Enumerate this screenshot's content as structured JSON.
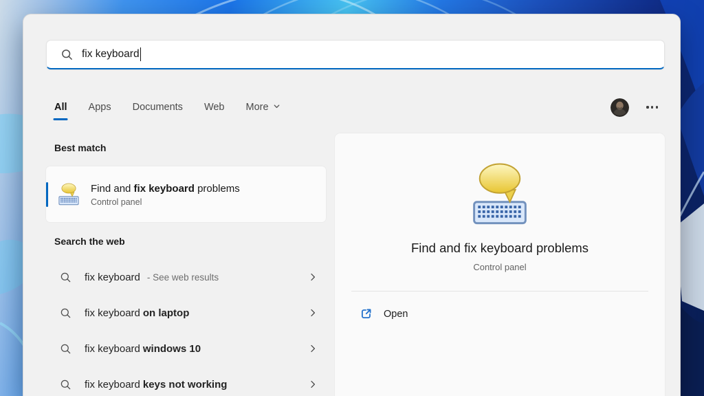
{
  "accent_color": "#0067c0",
  "search_bar": {
    "icon": "search-icon",
    "query": "fix keyboard"
  },
  "tabs": [
    "All",
    "Apps",
    "Documents",
    "Web",
    "More"
  ],
  "header_actions": {
    "avatar_icon": "user-avatar",
    "more_options_icon": "ellipsis"
  },
  "best_match": {
    "section_title": "Best match",
    "item": {
      "icon": "keyboard-troubleshooter-icon",
      "title_prefix": "Find and ",
      "title_bold": "fix keyboard",
      "title_suffix": " problems",
      "subtitle": "Control panel"
    }
  },
  "search_web": {
    "section_title": "Search the web",
    "items": [
      {
        "query": "fix keyboard",
        "bold": "",
        "annotation": "- See web results"
      },
      {
        "query": "fix keyboard",
        "bold": "on laptop",
        "annotation": ""
      },
      {
        "query": "fix keyboard",
        "bold": "windows 10",
        "annotation": ""
      },
      {
        "query": "fix keyboard",
        "bold": "keys not working",
        "annotation": ""
      }
    ]
  },
  "preview": {
    "icon": "keyboard-troubleshooter-icon",
    "title": "Find and fix keyboard problems",
    "subtitle": "Control panel",
    "open_icon": "open-external-icon",
    "open_label": "Open"
  }
}
